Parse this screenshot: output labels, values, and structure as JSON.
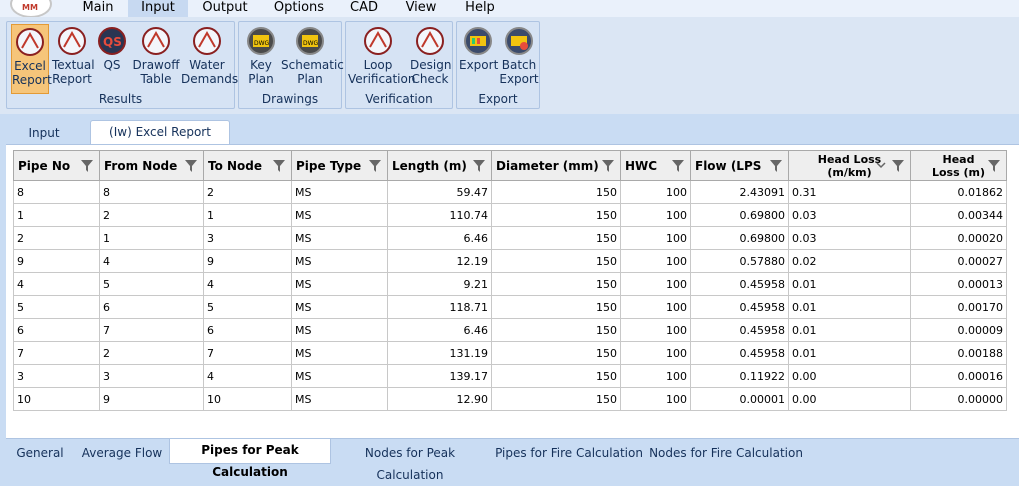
{
  "menu": [
    "Main",
    "Input",
    "Output",
    "Options",
    "CAD",
    "View",
    "Help"
  ],
  "ribbon": {
    "results": {
      "label": "Results",
      "buttons": [
        {
          "line1": "Excel",
          "line2": "Report",
          "icon": "excel-report-icon"
        },
        {
          "line1": "Textual",
          "line2": "Report",
          "icon": "textual-report-icon"
        },
        {
          "line1": "QS",
          "line2": "",
          "icon": "qs-icon"
        },
        {
          "line1": "Drawoff",
          "line2": "Table",
          "icon": "drawoff-table-icon"
        },
        {
          "line1": "Water",
          "line2": "Demands",
          "icon": "water-demands-icon"
        }
      ]
    },
    "drawings": {
      "label": "Drawings",
      "buttons": [
        {
          "line1": "Key",
          "line2": "Plan",
          "icon": "key-plan-icon"
        },
        {
          "line1": "Schematic",
          "line2": "Plan",
          "icon": "schematic-plan-icon"
        }
      ]
    },
    "verification": {
      "label": "Verification",
      "buttons": [
        {
          "line1": "Loop",
          "line2": "Verification",
          "icon": "loop-verification-icon"
        },
        {
          "line1": "Design",
          "line2": "Check",
          "icon": "design-check-icon"
        }
      ]
    },
    "export": {
      "label": "Export",
      "buttons": [
        {
          "line1": "Export",
          "line2": "",
          "icon": "export-icon"
        },
        {
          "line1": "Batch",
          "line2": "Export",
          "icon": "batch-export-icon"
        }
      ]
    }
  },
  "top_tabs": [
    "Input",
    "(Iw) Excel Report"
  ],
  "table": {
    "columns": [
      "Pipe No",
      "From Node",
      "To Node",
      "Pipe Type",
      "Length (m)",
      "Diameter (mm)",
      "HWC",
      "Flow (LPS",
      "Head Loss (m/km)",
      "Head Loss (m)"
    ],
    "rows": [
      [
        "8",
        "8",
        "2",
        "MS",
        "59.47",
        "150",
        "100",
        "2.43091",
        "0.31",
        "0.01862"
      ],
      [
        "1",
        "2",
        "1",
        "MS",
        "110.74",
        "150",
        "100",
        "0.69800",
        "0.03",
        "0.00344"
      ],
      [
        "2",
        "1",
        "3",
        "MS",
        "6.46",
        "150",
        "100",
        "0.69800",
        "0.03",
        "0.00020"
      ],
      [
        "9",
        "4",
        "9",
        "MS",
        "12.19",
        "150",
        "100",
        "0.57880",
        "0.02",
        "0.00027"
      ],
      [
        "4",
        "5",
        "4",
        "MS",
        "9.21",
        "150",
        "100",
        "0.45958",
        "0.01",
        "0.00013"
      ],
      [
        "5",
        "6",
        "5",
        "MS",
        "118.71",
        "150",
        "100",
        "0.45958",
        "0.01",
        "0.00170"
      ],
      [
        "6",
        "7",
        "6",
        "MS",
        "6.46",
        "150",
        "100",
        "0.45958",
        "0.01",
        "0.00009"
      ],
      [
        "7",
        "2",
        "7",
        "MS",
        "131.19",
        "150",
        "100",
        "0.45958",
        "0.01",
        "0.00188"
      ],
      [
        "3",
        "3",
        "4",
        "MS",
        "139.17",
        "150",
        "100",
        "0.11922",
        "0.00",
        "0.00016"
      ],
      [
        "10",
        "9",
        "10",
        "MS",
        "12.90",
        "150",
        "100",
        "0.00001",
        "0.00",
        "0.00000"
      ]
    ]
  },
  "bottom_tabs": [
    "General",
    "Average Flow",
    "Pipes for Peak Calculation",
    "Nodes for Peak Calculation",
    "Pipes for Fire Calculation",
    "Nodes for Fire Calculation"
  ]
}
